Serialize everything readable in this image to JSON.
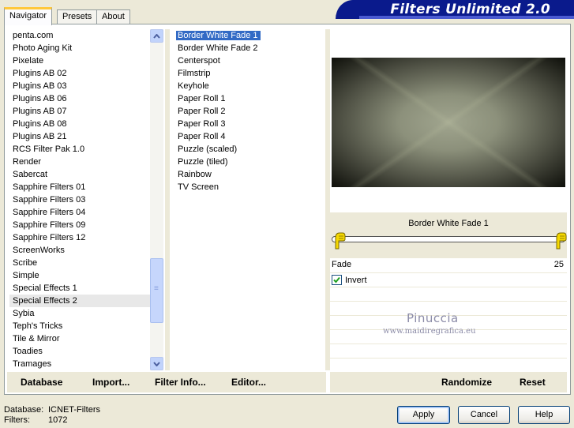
{
  "tabs": [
    "Navigator",
    "Presets",
    "About"
  ],
  "app_title": "Filters Unlimited 2.0",
  "categories": [
    "penta.com",
    "Photo Aging Kit",
    "Pixelate",
    "Plugins AB 02",
    "Plugins AB 03",
    "Plugins AB 06",
    "Plugins AB 07",
    "Plugins AB 08",
    "Plugins AB 21",
    "RCS Filter Pak 1.0",
    "Render",
    "Sabercat",
    "Sapphire Filters 01",
    "Sapphire Filters 03",
    "Sapphire Filters 04",
    "Sapphire Filters 09",
    "Sapphire Filters 12",
    "ScreenWorks",
    "Scribe",
    "Simple",
    "Special Effects 1",
    "Special Effects 2",
    "Sybia",
    "Teph's Tricks",
    "Tile & Mirror",
    "Toadies",
    "Tramages"
  ],
  "selected_category": "Special Effects 2",
  "filters": [
    "Border White Fade 1",
    "Border White Fade 2",
    "Centerspot",
    "Filmstrip",
    "Keyhole",
    "Paper Roll 1",
    "Paper Roll 2",
    "Paper Roll 3",
    "Paper Roll 4",
    "Puzzle (scaled)",
    "Puzzle (tiled)",
    "Rainbow",
    "TV Screen"
  ],
  "selected_filter": "Border White Fade 1",
  "params": {
    "filter_name": "Border White Fade 1",
    "fade_label": "Fade",
    "fade_value": "25",
    "invert_label": "Invert",
    "invert_checked": true
  },
  "watermark": {
    "name": "Pinuccia",
    "url": "www.maidiregrafica.eu"
  },
  "left_buttons": {
    "database": "Database",
    "import": "Import...",
    "filter_info": "Filter Info...",
    "editor": "Editor..."
  },
  "right_buttons": {
    "randomize": "Randomize",
    "reset": "Reset"
  },
  "info": {
    "database_label": "Database:",
    "database_value": "ICNET-Filters",
    "filters_label": "Filters:",
    "filters_value": "1072"
  },
  "dialog_buttons": {
    "apply": "Apply",
    "cancel": "Cancel",
    "help": "Help"
  },
  "colors": {
    "title_bar": "#0a1a8c",
    "selection": "#316ac5",
    "tab_highlight": "#ffc83c"
  }
}
